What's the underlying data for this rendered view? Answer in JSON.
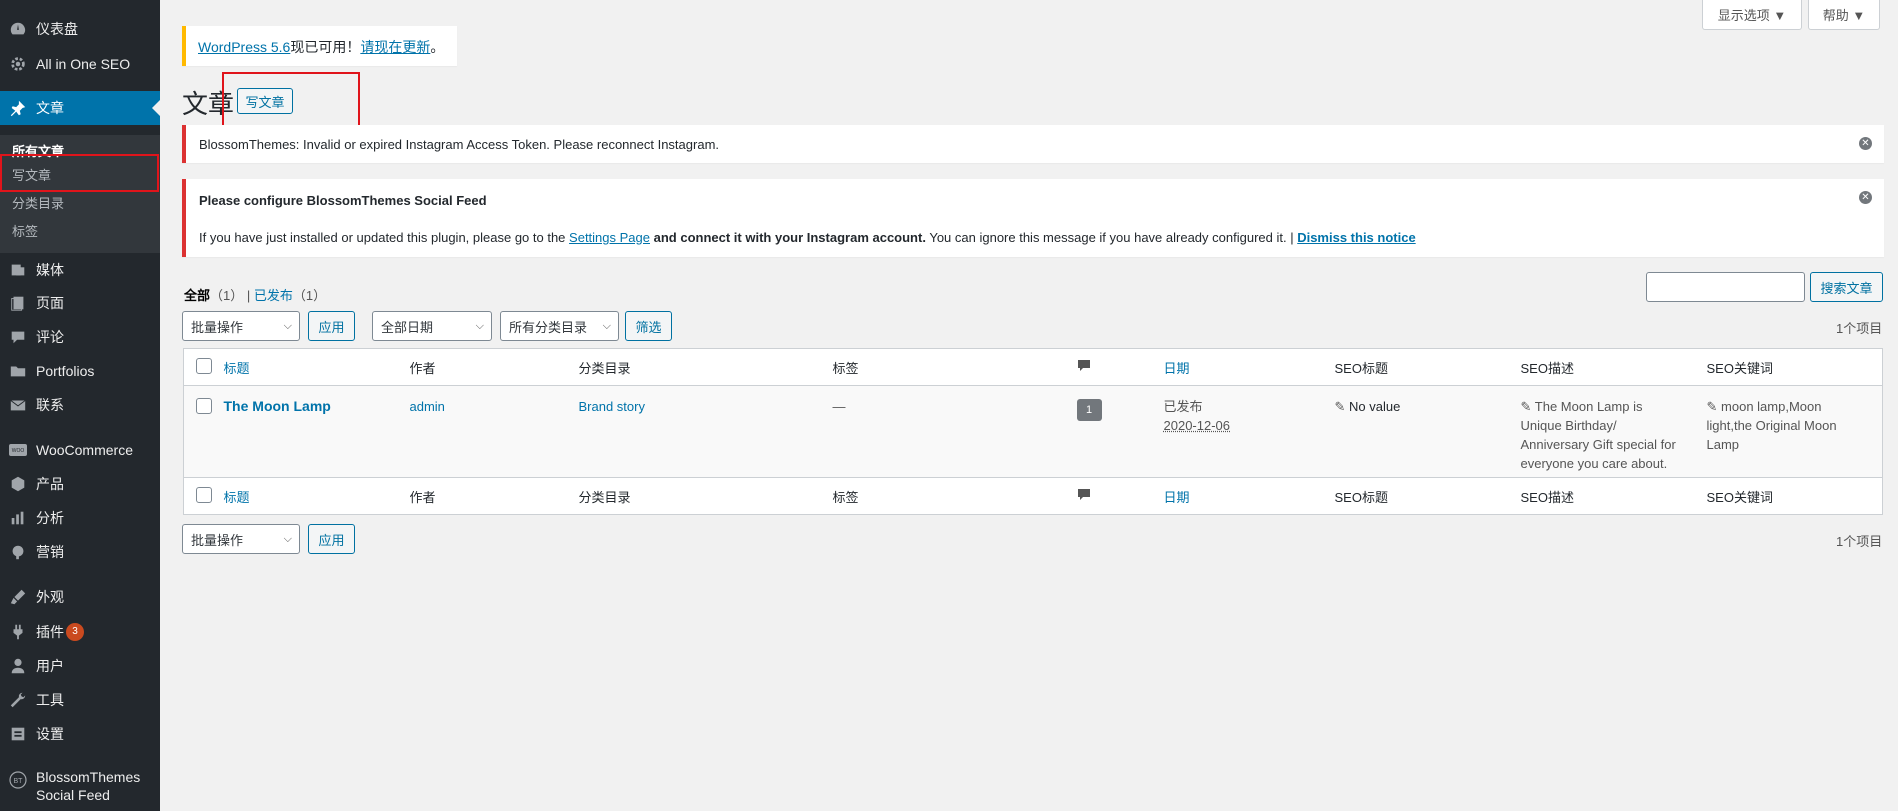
{
  "sidebar": {
    "items": [
      {
        "label": "仪表盘",
        "icon": "dashboard-icon"
      },
      {
        "label": "All in One SEO",
        "icon": "gear-icon"
      },
      {
        "label": "文章",
        "icon": "pin-icon"
      },
      {
        "label": "媒体",
        "icon": "media-icon"
      },
      {
        "label": "页面",
        "icon": "page-icon"
      },
      {
        "label": "评论",
        "icon": "comment-icon"
      },
      {
        "label": "Portfolios",
        "icon": "folder-icon"
      },
      {
        "label": "联系",
        "icon": "mail-icon"
      },
      {
        "label": "WooCommerce",
        "icon": "woo-icon"
      },
      {
        "label": "产品",
        "icon": "cube-icon"
      },
      {
        "label": "分析",
        "icon": "bar-chart-icon"
      },
      {
        "label": "营销",
        "icon": "megaphone-icon"
      },
      {
        "label": "外观",
        "icon": "brush-icon"
      },
      {
        "label": "插件",
        "icon": "plugin-icon",
        "badge": "3"
      },
      {
        "label": "用户",
        "icon": "user-icon"
      },
      {
        "label": "工具",
        "icon": "wrench-icon"
      },
      {
        "label": "设置",
        "icon": "settings-icon"
      },
      {
        "label": "BlossomThemes",
        "label2": "Social Feed",
        "icon": "bt-icon"
      }
    ],
    "submenu": [
      "所有文章",
      "写文章",
      "分类目录",
      "标签"
    ]
  },
  "top": {
    "screen_options": "显示选项 ▼",
    "help": "帮助 ▼"
  },
  "update_notice": {
    "link1": "WordPress 5.6",
    "text": "现已可用！",
    "link2": "请现在更新",
    "end": "。"
  },
  "page": {
    "title": "文章",
    "add_new": "写文章"
  },
  "notice1": {
    "text": "BlossomThemes: Invalid or expired Instagram Access Token. Please reconnect Instagram."
  },
  "notice2": {
    "title": "Please configure BlossomThemes Social Feed",
    "t1": "If you have just installed or updated this plugin, please go to the",
    "link1": "Settings Page",
    "bold": "and connect it with your Instagram account.",
    "t2": "You can ignore this message if you have already configured it. |",
    "link2": "Dismiss this notice"
  },
  "filters": {
    "all": "全部",
    "all_count": "（1）",
    "sep": "|",
    "published": "已发布",
    "published_count": "（1）",
    "bulk": "批量操作",
    "apply": "应用",
    "dates": "全部日期",
    "cats": "所有分类目录",
    "filter": "筛选",
    "search_button": "搜索文章",
    "search_value": "",
    "count": "1个项目"
  },
  "table": {
    "headers": {
      "title": "标题",
      "author": "作者",
      "category": "分类目录",
      "tags": "标签",
      "date": "日期",
      "seo_title": "SEO标题",
      "seo_desc": "SEO描述",
      "seo_kw": "SEO关键词"
    },
    "row": {
      "title": "The Moon Lamp",
      "author": "admin",
      "category": "Brand story",
      "tags": "—",
      "comments": "1",
      "status": "已发布",
      "date": "2020-12-06",
      "seo_title": "No value",
      "seo_desc": [
        "The Moon Lamp is",
        "Unique Birthday/",
        "Anniversary Gift special for",
        "everyone you care about."
      ],
      "seo_kw": [
        "moon lamp,Moon",
        "light,the Original Moon",
        "Lamp"
      ]
    }
  },
  "bottom": {
    "bulk": "批量操作",
    "apply": "应用",
    "count": "1个项目"
  }
}
